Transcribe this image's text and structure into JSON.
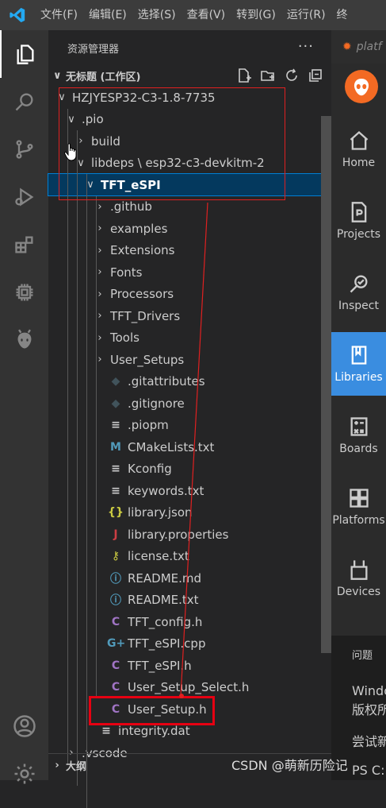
{
  "menubar": {
    "items": [
      "文件(F)",
      "编辑(E)",
      "选择(S)",
      "查看(V)",
      "转到(G)",
      "运行(R)",
      "终"
    ]
  },
  "sidebar": {
    "title": "资源管理器",
    "more": "···",
    "workspace": "无标题 (工作区)",
    "outline": "大纲"
  },
  "tree": [
    {
      "label": "HZJYESP32-C3-1.8-7735",
      "twisty": "∨",
      "icon": "",
      "color": "#ccc",
      "depth": 0
    },
    {
      "label": ".pio",
      "twisty": "∨",
      "icon": "",
      "color": "#ccc",
      "depth": 1
    },
    {
      "label": "build",
      "twisty": "›",
      "icon": "",
      "color": "#ccc",
      "depth": 2
    },
    {
      "label": "libdeps \\ esp32-c3-devkitm-2",
      "twisty": "∨",
      "icon": "",
      "color": "#ccc",
      "depth": 2
    },
    {
      "label": "TFT_eSPI",
      "twisty": "∨",
      "icon": "",
      "color": "#ccc",
      "depth": 3,
      "selected": true
    },
    {
      "label": ".github",
      "twisty": "›",
      "icon": "",
      "color": "#ccc",
      "depth": 4
    },
    {
      "label": "examples",
      "twisty": "›",
      "icon": "",
      "color": "#ccc",
      "depth": 4
    },
    {
      "label": "Extensions",
      "twisty": "›",
      "icon": "",
      "color": "#ccc",
      "depth": 4
    },
    {
      "label": "Fonts",
      "twisty": "›",
      "icon": "",
      "color": "#ccc",
      "depth": 4
    },
    {
      "label": "Processors",
      "twisty": "›",
      "icon": "",
      "color": "#ccc",
      "depth": 4
    },
    {
      "label": "TFT_Drivers",
      "twisty": "›",
      "icon": "",
      "color": "#ccc",
      "depth": 4
    },
    {
      "label": "Tools",
      "twisty": "›",
      "icon": "",
      "color": "#ccc",
      "depth": 4
    },
    {
      "label": "User_Setups",
      "twisty": "›",
      "icon": "",
      "color": "#ccc",
      "depth": 4
    },
    {
      "label": ".gitattributes",
      "twisty": "",
      "icon": "◆",
      "color": "#41535b",
      "depth": 4
    },
    {
      "label": ".gitignore",
      "twisty": "",
      "icon": "◆",
      "color": "#41535b",
      "depth": 4
    },
    {
      "label": ".piopm",
      "twisty": "",
      "icon": "≡",
      "color": "#ccc",
      "depth": 4
    },
    {
      "label": "CMakeLists.txt",
      "twisty": "",
      "icon": "M",
      "color": "#519aba",
      "depth": 4
    },
    {
      "label": "Kconfig",
      "twisty": "",
      "icon": "≡",
      "color": "#ccc",
      "depth": 4
    },
    {
      "label": "keywords.txt",
      "twisty": "",
      "icon": "≡",
      "color": "#ccc",
      "depth": 4
    },
    {
      "label": "library.json",
      "twisty": "",
      "icon": "{}",
      "color": "#cbcb41",
      "depth": 4
    },
    {
      "label": "library.properties",
      "twisty": "",
      "icon": "J",
      "color": "#cc3e44",
      "depth": 4
    },
    {
      "label": "license.txt",
      "twisty": "",
      "icon": "⚷",
      "color": "#cbcb41",
      "depth": 4
    },
    {
      "label": "README.md",
      "twisty": "",
      "icon": "ⓘ",
      "color": "#519aba",
      "depth": 4
    },
    {
      "label": "README.txt",
      "twisty": "",
      "icon": "ⓘ",
      "color": "#519aba",
      "depth": 4
    },
    {
      "label": "TFT_config.h",
      "twisty": "",
      "icon": "C",
      "color": "#a074c4",
      "depth": 4
    },
    {
      "label": "TFT_eSPI.cpp",
      "twisty": "",
      "icon": "G+",
      "color": "#519aba",
      "depth": 4
    },
    {
      "label": "TFT_eSPI.h",
      "twisty": "",
      "icon": "C",
      "color": "#a074c4",
      "depth": 4
    },
    {
      "label": "User_Setup_Select.h",
      "twisty": "",
      "icon": "C",
      "color": "#a074c4",
      "depth": 4
    },
    {
      "label": "User_Setup.h",
      "twisty": "",
      "icon": "C",
      "color": "#a074c4",
      "depth": 4
    },
    {
      "label": "integrity.dat",
      "twisty": "",
      "icon": "≡",
      "color": "#ccc",
      "depth": 3
    },
    {
      "label": ".vscode",
      "twisty": "›",
      "icon": "",
      "color": "#ccc",
      "depth": 1
    }
  ],
  "pio": {
    "tab": "platf",
    "items": [
      "Home",
      "Projects",
      "Inspect",
      "Libraries",
      "Boards",
      "Platforms",
      "Devices"
    ]
  },
  "panel": {
    "tab": "问题",
    "lines": [
      "Windo",
      "版权所",
      "尝试新",
      "PS C:"
    ]
  },
  "watermark": "CSDN @萌新历险记",
  "colors": {
    "accent": "#3a8de0",
    "selected": "#04395e",
    "annotation": "#e60012"
  }
}
